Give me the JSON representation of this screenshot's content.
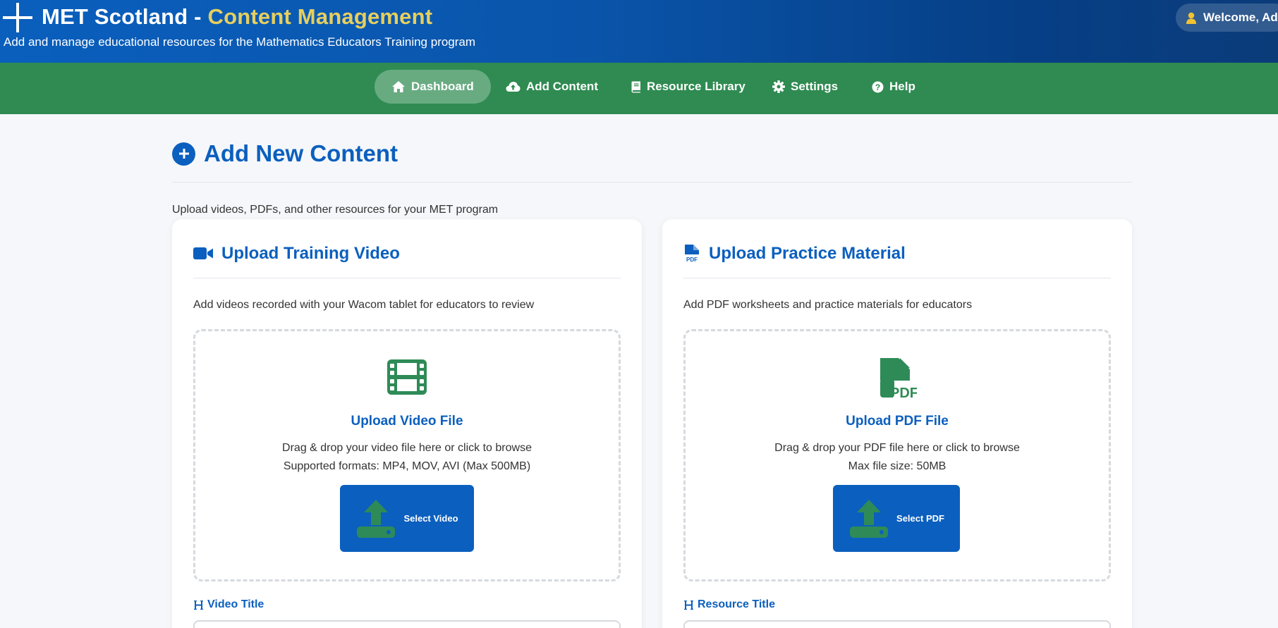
{
  "header": {
    "title_main": "MET Scotland - ",
    "title_accent": "Content Management",
    "subtitle": "Add and manage educational resources for the Mathematics Educators Training program",
    "welcome": "Welcome, Admin"
  },
  "nav": {
    "items": [
      {
        "label": "Dashboard",
        "icon": "home-icon",
        "active": true
      },
      {
        "label": "Add Content",
        "icon": "cloud-upload-icon",
        "active": false
      },
      {
        "label": "Resource Library",
        "icon": "book-icon",
        "active": false
      },
      {
        "label": "Settings",
        "icon": "gear-icon",
        "active": false
      },
      {
        "label": "Help",
        "icon": "question-icon",
        "active": false
      }
    ]
  },
  "main": {
    "title": "Add New Content",
    "description": "Upload videos, PDFs, and other resources for your MET program"
  },
  "video_card": {
    "title": "Upload Training Video",
    "description": "Add videos recorded with your Wacom tablet for educators to review",
    "dropzone_title": "Upload Video File",
    "dropzone_text": "Drag & drop your video file here or click to browse",
    "dropzone_formats": "Supported formats: MP4, MOV, AVI (Max 500MB)",
    "button_label": "Select Video",
    "field_label": "Video Title"
  },
  "pdf_card": {
    "title": "Upload Practice Material",
    "description": "Add PDF worksheets and practice materials for educators",
    "dropzone_title": "Upload PDF File",
    "dropzone_text": "Drag & drop your PDF file here or click to browse",
    "dropzone_formats": "Max file size: 50MB",
    "button_label": "Select PDF",
    "field_label": "Resource Title"
  },
  "colors": {
    "primary": "#0b5fbe",
    "nav_green": "#2f8b51",
    "accent_gold": "#e6cf5e",
    "icon_green": "#2e8b57"
  }
}
